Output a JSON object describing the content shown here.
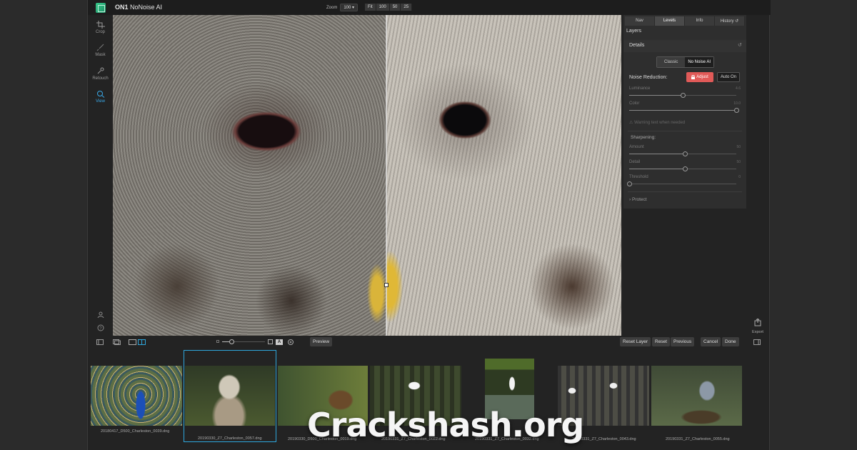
{
  "app": {
    "brand": "ON1",
    "title": "NoNoise AI"
  },
  "zoom": {
    "label": "Zoom",
    "value": "100",
    "presets": [
      "Fit",
      "100",
      "50",
      "25"
    ]
  },
  "tools": [
    {
      "label": "Crop",
      "icon": "crop-icon",
      "active": false
    },
    {
      "label": "Mask",
      "icon": "mask-brush-icon",
      "active": false
    },
    {
      "label": "Retouch",
      "icon": "retouch-icon",
      "active": false
    },
    {
      "label": "View",
      "icon": "view-magnifier-icon",
      "active": true
    }
  ],
  "panel": {
    "tabs": [
      "Nav",
      "Levels",
      "Info",
      "History"
    ],
    "active_tab": "Levels",
    "layers_label": "Layers",
    "details_label": "Details",
    "modes": [
      "Classic",
      "No Noise AI"
    ],
    "active_mode": "No Noise AI",
    "noise_reduction_label": "Noise Reduction:",
    "adjust_label": "Adjust",
    "auto_on_label": "Auto On",
    "luminance": {
      "label": "Luminance",
      "value": "4.6",
      "level": 0.5
    },
    "color": {
      "label": "Color",
      "value": "10.0",
      "level": 1.0
    },
    "warning": "Warning text when needed",
    "sharpening_label": "Sharpening:",
    "amount": {
      "label": "Amount",
      "value": "50",
      "level": 0.52
    },
    "detail": {
      "label": "Detail",
      "value": "50",
      "level": 0.52
    },
    "threshold": {
      "label": "Threshold",
      "value": "0",
      "level": 0.0
    },
    "protect_label": "Protect"
  },
  "bottom": {
    "preview": "Preview",
    "reset_layer": "Reset Layer",
    "reset": "Reset",
    "previous": "Previous",
    "cancel": "Cancel",
    "done": "Done",
    "mask_letter": "A"
  },
  "filmstrip": [
    {
      "caption": "20180417_D500_Charleston_0039.dng",
      "subject": "peacock"
    },
    {
      "caption": "20190330_Z7_Charleston_0057.dng",
      "subject": "owl",
      "selected": true
    },
    {
      "caption": "20190330_D500_Charleston_0019.dng",
      "subject": "eagle"
    },
    {
      "caption": "20190331_Z7_Charleston_0022.dng",
      "subject": "egret-flying"
    },
    {
      "caption": "20190331_Z7_Charleston_0032.dng",
      "subject": "egret-standing"
    },
    {
      "caption": "20190331_Z7_Charleston_0043.dng",
      "subject": "egrets-nest"
    },
    {
      "caption": "20190331_Z7_Charleston_0055.dng",
      "subject": "heron"
    }
  ],
  "export_label": "Export",
  "watermark": "Crackshash.org",
  "colors": {
    "accent": "#2ea6dc",
    "adjust": "#e05a58",
    "brand": "#38c98a"
  }
}
